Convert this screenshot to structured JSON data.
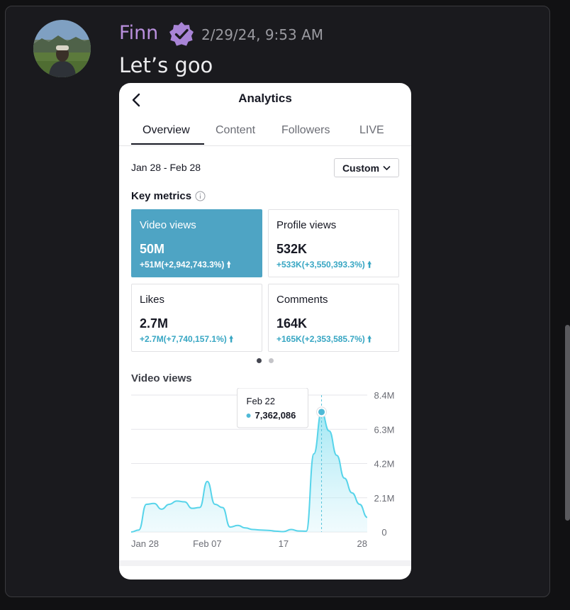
{
  "message": {
    "username": "Finn",
    "timestamp": "2/29/24, 9:53 AM",
    "text": "Let’s goo",
    "username_color": "#b98fdd"
  },
  "analytics": {
    "title": "Analytics",
    "tabs": [
      {
        "label": "Overview",
        "active": true
      },
      {
        "label": "Content",
        "active": false
      },
      {
        "label": "Followers",
        "active": false
      },
      {
        "label": "LIVE",
        "active": false
      }
    ],
    "date_range": "Jan 28 - Feb 28",
    "range_button": "Custom",
    "key_metrics_label": "Key metrics",
    "metrics": [
      {
        "label": "Video views",
        "value": "50M",
        "change": "+51M(+2,942,743.3%)",
        "selected": true
      },
      {
        "label": "Profile views",
        "value": "532K",
        "change": "+533K(+3,550,393.3%)",
        "selected": false
      },
      {
        "label": "Likes",
        "value": "2.7M",
        "change": "+2.7M(+7,740,157.1%)",
        "selected": false
      },
      {
        "label": "Comments",
        "value": "164K",
        "change": "+165K(+2,353,585.7%)",
        "selected": false
      }
    ],
    "accent_color": "#4ea4c4",
    "change_color": "#37a6c3",
    "page_dots": {
      "count": 2,
      "active": 0
    }
  },
  "chart_data": {
    "type": "area",
    "title": "Video views",
    "xlabel": "",
    "ylabel": "",
    "x": [
      "Jan 28",
      "Jan 29",
      "Jan 30",
      "Jan 31",
      "Feb 01",
      "Feb 02",
      "Feb 03",
      "Feb 04",
      "Feb 05",
      "Feb 06",
      "Feb 07",
      "Feb 08",
      "Feb 09",
      "Feb 10",
      "Feb 11",
      "Feb 12",
      "Feb 13",
      "Feb 14",
      "Feb 15",
      "Feb 16",
      "Feb 17",
      "Feb 18",
      "Feb 19",
      "Feb 20",
      "Feb 21",
      "Feb 22",
      "Feb 23",
      "Feb 24",
      "Feb 25",
      "Feb 26",
      "Feb 27",
      "Feb 28"
    ],
    "series": [
      {
        "values": [
          0,
          120000,
          1700000,
          1750000,
          1400000,
          1700000,
          1900000,
          1850000,
          1450000,
          1500000,
          3100000,
          1700000,
          1500000,
          300000,
          400000,
          250000,
          150000,
          120000,
          100000,
          50000,
          20000,
          150000,
          60000,
          50000,
          4800000,
          7362086,
          6200000,
          4700000,
          3300000,
          2400000,
          1700000,
          900000
        ]
      }
    ],
    "x_tick_labels": [
      "Jan 28",
      "Feb 07",
      "17",
      "28"
    ],
    "y_tick_labels": [
      "0",
      "2.1M",
      "4.2M",
      "6.3M",
      "8.4M"
    ],
    "ylim": [
      0,
      8400000
    ],
    "grid": true,
    "line_color": "#57d4ea",
    "fill_color": "#d6f4fb",
    "tooltip": {
      "date": "Feb 22",
      "value": "7,362,086",
      "index": 25
    }
  },
  "scrollbar_color": "#5a5a5e"
}
